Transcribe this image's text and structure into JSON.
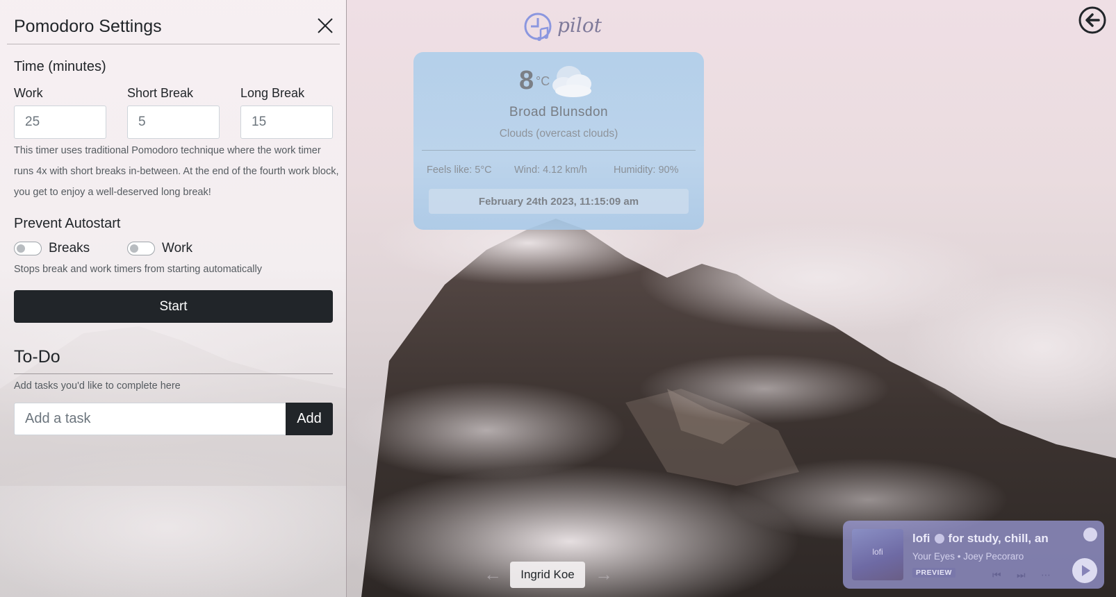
{
  "sidebar": {
    "title": "Pomodoro Settings",
    "time_section_title": "Time (minutes)",
    "work_label": "Work",
    "work_value": "25",
    "short_break_label": "Short Break",
    "short_break_value": "5",
    "long_break_label": "Long Break",
    "long_break_value": "15",
    "description": "This timer uses traditional Pomodoro technique where the work timer runs 4x with short breaks in-between. At the end of the fourth work block, you get to enjoy a well-deserved long break!",
    "autostart_title": "Prevent Autostart",
    "toggle_breaks_label": "Breaks",
    "toggle_work_label": "Work",
    "toggle_breaks_on": false,
    "toggle_work_on": false,
    "autostart_help": "Stops break and work timers from starting automatically",
    "start_label": "Start"
  },
  "todo": {
    "title": "To-Do",
    "help": "Add tasks you'd like to complete here",
    "input_placeholder": "Add a task",
    "add_label": "Add"
  },
  "logo": {
    "text": "pilot"
  },
  "weather": {
    "temp": "8",
    "unit": "°C",
    "city": "Broad Blunsdon",
    "description": "Clouds (overcast clouds)",
    "feels_like": "Feels like: 5°C",
    "wind": "Wind: 4.12 km/h",
    "humidity": "Humidity: 90%",
    "datetime": "February 24th 2023, 11:15:09 am",
    "icon": "cloud-icon"
  },
  "spotify": {
    "art_label": "lofi",
    "title_part1": "lofi",
    "title_part2": "for study, chill, an",
    "artist": "Your Eyes • Joey Pecoraro",
    "badge": "PREVIEW"
  },
  "photo_credit": "Ingrid Koe",
  "colors": {
    "dark_button": "#212529",
    "weather_card": "#b2d2ee",
    "spotify_widget": "#9e9ede"
  }
}
